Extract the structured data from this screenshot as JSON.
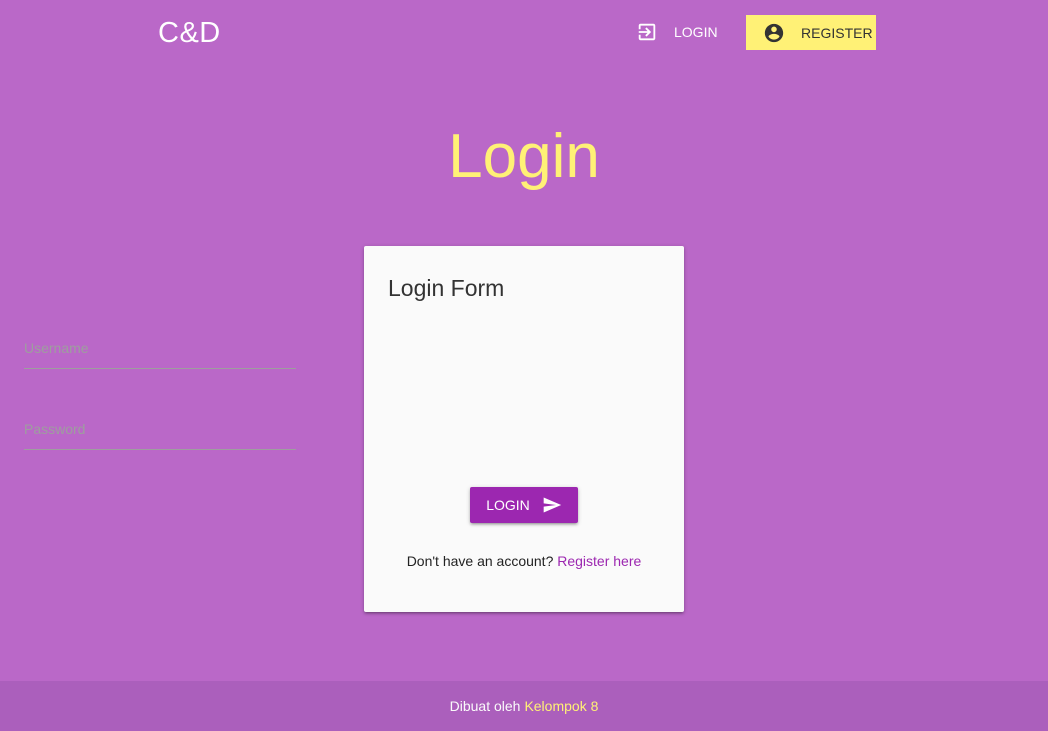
{
  "nav": {
    "brand": "C&D",
    "login_label": "LOGIN",
    "login_icon": "login-icon",
    "register_label": "REGISTER",
    "register_icon": "account-circle-icon"
  },
  "page": {
    "title": "Login"
  },
  "form": {
    "title": "Login Form",
    "username": {
      "placeholder": "Username",
      "value": ""
    },
    "password": {
      "placeholder": "Password",
      "value": ""
    },
    "submit_label": "LOGIN",
    "submit_icon": "send-icon",
    "signup_prompt": "Don't have an account?",
    "signup_link": "Register here"
  },
  "footer": {
    "text": "Dibuat oleh",
    "link": "Kelompok 8"
  },
  "colors": {
    "background": "#ba68c8",
    "accent": "#fff176",
    "primary": "#9c27b0",
    "card": "#fafafa",
    "footer": "#ab5fbc"
  }
}
